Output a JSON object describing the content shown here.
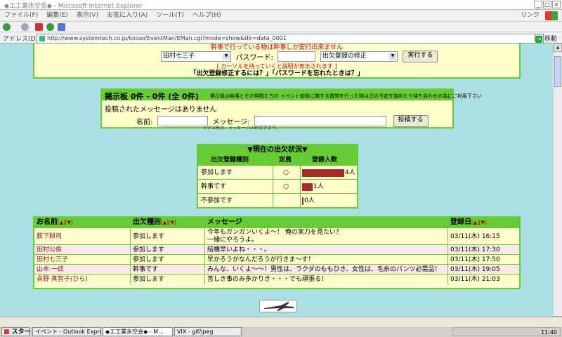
{
  "window": {
    "title": "◆エ工業氷空会◆ - Microsoft Internet Explorer"
  },
  "menu": {
    "items": [
      "ファイル(F)",
      "編集(E)",
      "表示(V)",
      "お気に入り(A)",
      "ツール(T)",
      "ヘルプ(H)"
    ],
    "link": "リンク"
  },
  "address": {
    "label": "アドレス(D)",
    "url": "http://www.systemtech.co.jp/koisei/EventMan/EMan.cgi?mode=show&dir=data_0001",
    "go": "移動"
  },
  "login": {
    "notice": "幹事で行っている物は幹事しか実行出来ません",
    "member_select": "田村七三子",
    "password_label": "パスワード:",
    "action_select": "出欠登録の修正",
    "run_button": "実行する",
    "hint": "[ カーソルを持っていくと説明が表示されます ]",
    "links": "「出欠登録修正するには？」「パスワードを忘れたときは？」"
  },
  "board": {
    "title": "掲示板 0件 - 0件 (全 0件)",
    "description": "掲示板は幹事とその仲間たちの イベント前後に関する質問を行った時は日の予定を詰めたり待ち合わせの為にご利用下さい",
    "empty": "投稿されたメッセージはありません",
    "name_label": "名前:",
    "message_label": "メッセージ:",
    "post_button": "投稿する",
    "note": "タグは無効、メッセージは80文字まで。"
  },
  "status": {
    "title": "▼現在の出欠状況▼",
    "headers": [
      "出欠登録種別",
      "定員",
      "登録人数"
    ],
    "rows": [
      {
        "type": "参加します",
        "capacity": "○",
        "count": 4,
        "count_label": "4人"
      },
      {
        "type": "幹事です",
        "capacity": "○",
        "count": 1,
        "count_label": "1人"
      },
      {
        "type": "不参加です",
        "capacity": "",
        "count": 0,
        "count_label": "0人"
      }
    ]
  },
  "messages": {
    "headers": [
      "お名前",
      "出欠種別",
      "メッセージ",
      "登録日"
    ],
    "sort_marks": "[▲][▼]",
    "rows": [
      {
        "name": "薮下耕司",
        "type": "参加します",
        "message": "今年もガンガンいくよ～！ 俺の実力を見たい？",
        "message2": "一緒にやろうよ。",
        "date": "03/11(木) 16:15"
      },
      {
        "name": "田村公俊",
        "type": "参加します",
        "message": "結構早いよね・・・。",
        "message2": "",
        "date": "03/11(木) 17:30"
      },
      {
        "name": "田村七三子",
        "type": "参加します",
        "message": "早かろうがなんだろうが行きま～す！",
        "message2": "",
        "date": "03/11(木) 17:50"
      },
      {
        "name": "山本 一誌",
        "type": "幹事です",
        "message": "みんな、いくよ～～！男性は、ラクダのももひき、女性は、毛糸のパンツ必需品！",
        "message2": "",
        "date": "03/11(木) 19:05"
      },
      {
        "name": "貞野 真智子(ひら)",
        "type": "参加します",
        "message": "苦しき事のみ多かりき・・・でも頑張る！",
        "message2": "",
        "date": "03/11(木) 21:03"
      }
    ]
  },
  "taskbar": {
    "start": "スタート",
    "tasks": [
      "イベント - Outlook Expre...",
      "◆エ工業氷空会◆ - M...",
      "VIX - gif/jpeg"
    ],
    "clock": "11:40"
  },
  "colors": {
    "content_bg": "#abdfe3",
    "panel_bg": "#ffffcc",
    "border": "#66cc33",
    "bar": "#a52a2a"
  }
}
